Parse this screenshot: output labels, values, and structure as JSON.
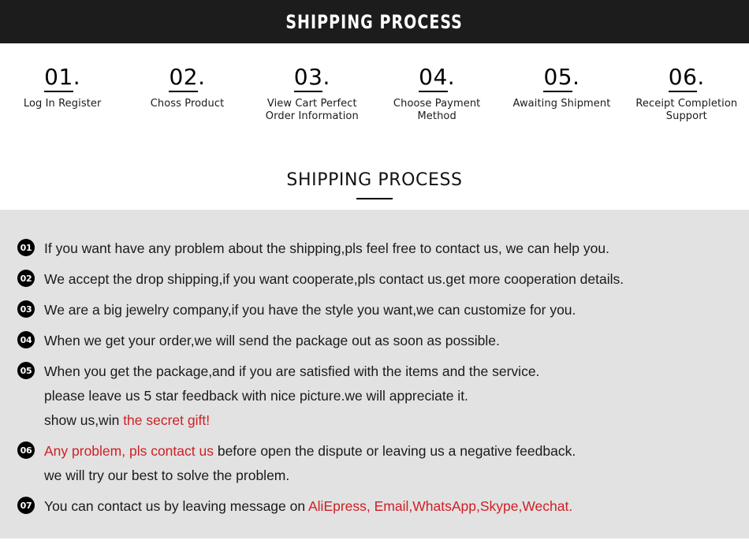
{
  "banner": {
    "title": "SHIPPING PROCESS",
    "background": "#1c1c1c",
    "text_color": "#ffffff"
  },
  "steps": [
    {
      "number": "01",
      "dot": ".",
      "label": "Log In Register"
    },
    {
      "number": "02",
      "dot": ".",
      "label": "Choss Product"
    },
    {
      "number": "03",
      "dot": ".",
      "label": "View Cart Perfect\nOrder Information"
    },
    {
      "number": "04",
      "dot": ".",
      "label": "Choose Payment\nMethod"
    },
    {
      "number": "05",
      "dot": ".",
      "label": "Awaiting Shipment"
    },
    {
      "number": "06",
      "dot": ".",
      "label": "Receipt Completion\nSupport"
    }
  ],
  "section": {
    "subtitle": "SHIPPING PROCESS"
  },
  "panel": {
    "background": "#e2e2e2",
    "accent_red": "#cf1f25",
    "items": [
      {
        "badge": "01",
        "lines": [
          [
            {
              "text": "If you want have any problem about the shipping,pls feel free to contact us, we can help you.",
              "color": "black"
            }
          ]
        ]
      },
      {
        "badge": "02",
        "lines": [
          [
            {
              "text": "We accept the drop shipping,if you want cooperate,pls contact us.get more cooperation details.",
              "color": "black"
            }
          ]
        ]
      },
      {
        "badge": "03",
        "lines": [
          [
            {
              "text": "We are a big jewelry company,if you have the style you want,we can customize for you.",
              "color": "black"
            }
          ]
        ]
      },
      {
        "badge": "04",
        "lines": [
          [
            {
              "text": "When we get your order,we will send the package out as soon as possible.",
              "color": "black"
            }
          ]
        ]
      },
      {
        "badge": "05",
        "lines": [
          [
            {
              "text": "When you get the package,and if you are satisfied with the items and the service.",
              "color": "black"
            }
          ],
          [
            {
              "text": "please leave us 5 star feedback with nice picture.we will appreciate it.",
              "color": "black"
            }
          ],
          [
            {
              "text": "show us,win ",
              "color": "black"
            },
            {
              "text": "the secret gift!",
              "color": "red"
            }
          ]
        ]
      },
      {
        "badge": "06",
        "lines": [
          [
            {
              "text": "Any problem, pls contact us",
              "color": "red"
            },
            {
              "text": " before open the dispute or leaving us a negative feedback.",
              "color": "black"
            }
          ],
          [
            {
              "text": "we will try our best to solve the problem.",
              "color": "black"
            }
          ]
        ]
      },
      {
        "badge": "07",
        "lines": [
          [
            {
              "text": "You can contact us by leaving message on ",
              "color": "black"
            },
            {
              "text": "AliEpress, Email,WhatsApp,Skype,Wechat.",
              "color": "red"
            }
          ]
        ]
      }
    ]
  }
}
